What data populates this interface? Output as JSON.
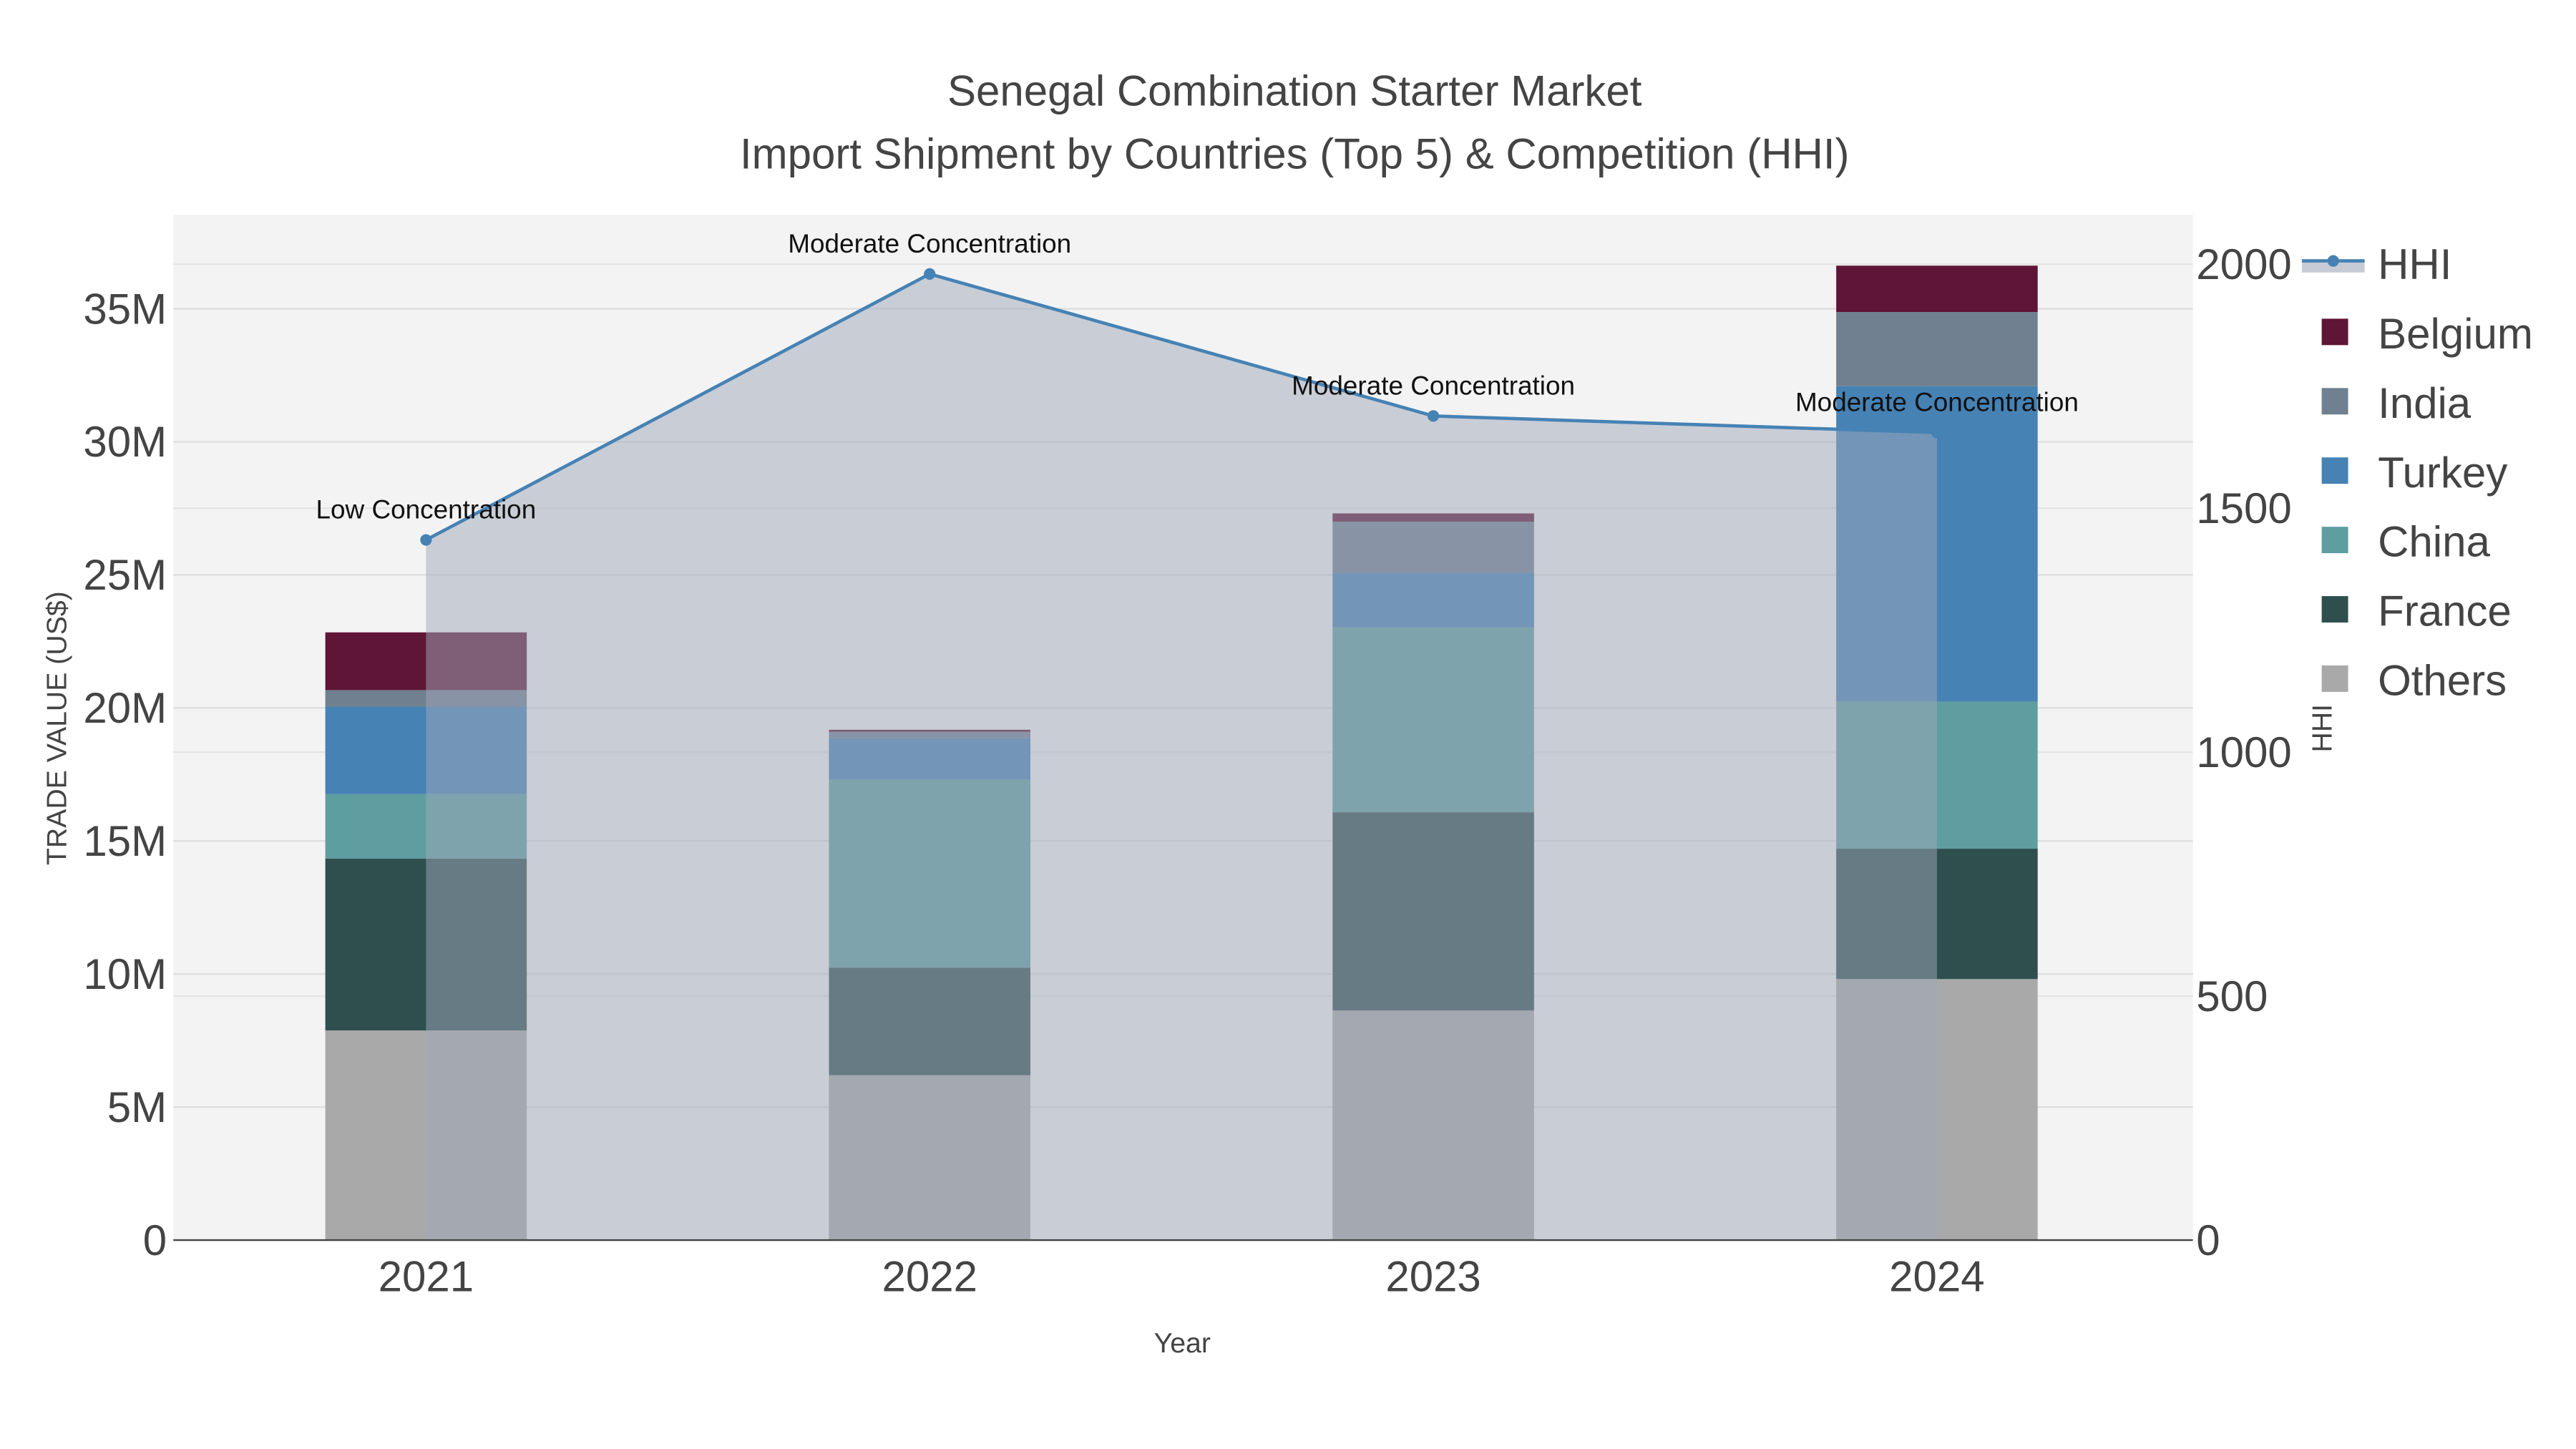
{
  "chart_data": {
    "type": "bar",
    "stacked": true,
    "title": "Senegal Combination Starter Market",
    "subtitle": "Import Shipment by Countries (Top 5) & Competition (HHI)",
    "xlabel": "Year",
    "ylabel": "TRADE VALUE (US$)",
    "y2label": "HHI",
    "categories": [
      "2021",
      "2022",
      "2023",
      "2024"
    ],
    "ylim": [
      0,
      38500000
    ],
    "y2lim": [
      0,
      2100
    ],
    "yticks": [
      0,
      5000000,
      10000000,
      15000000,
      20000000,
      25000000,
      30000000,
      35000000
    ],
    "ytick_labels": [
      "0",
      "5M",
      "10M",
      "15M",
      "20M",
      "25M",
      "30M",
      "35M"
    ],
    "y2ticks": [
      0,
      500,
      1000,
      1500,
      2000
    ],
    "y2tick_labels": [
      "0",
      "500",
      "1000",
      "1500",
      "2000"
    ],
    "series": [
      {
        "name": "Others",
        "color": "#a9a9a9",
        "values": [
          7880000,
          6200000,
          8630000,
          9810000
        ]
      },
      {
        "name": "France",
        "color": "#2f4f4f",
        "values": [
          6460000,
          4040000,
          7450000,
          4900000
        ]
      },
      {
        "name": "China",
        "color": "#5f9ea0",
        "values": [
          2420000,
          7060000,
          6950000,
          5530000
        ]
      },
      {
        "name": "Turkey",
        "color": "#4682b4",
        "values": [
          3290000,
          1570000,
          2050000,
          11850000
        ]
      },
      {
        "name": "India",
        "color": "#708090",
        "values": [
          620000,
          230000,
          1920000,
          2790000
        ]
      },
      {
        "name": "Belgium",
        "color": "#5f1535",
        "values": [
          2170000,
          80000,
          310000,
          1740000
        ]
      }
    ],
    "hhi": {
      "name": "HHI",
      "color": "#4682b4",
      "values": [
        1435,
        1980,
        1689,
        1655
      ],
      "annotations": [
        "Low Concentration",
        "Moderate Concentration",
        "Moderate Concentration",
        "Moderate Concentration"
      ]
    },
    "legend": [
      "HHI",
      "Belgium",
      "India",
      "Turkey",
      "China",
      "France",
      "Others"
    ],
    "legend_position": "right",
    "grid": true
  }
}
